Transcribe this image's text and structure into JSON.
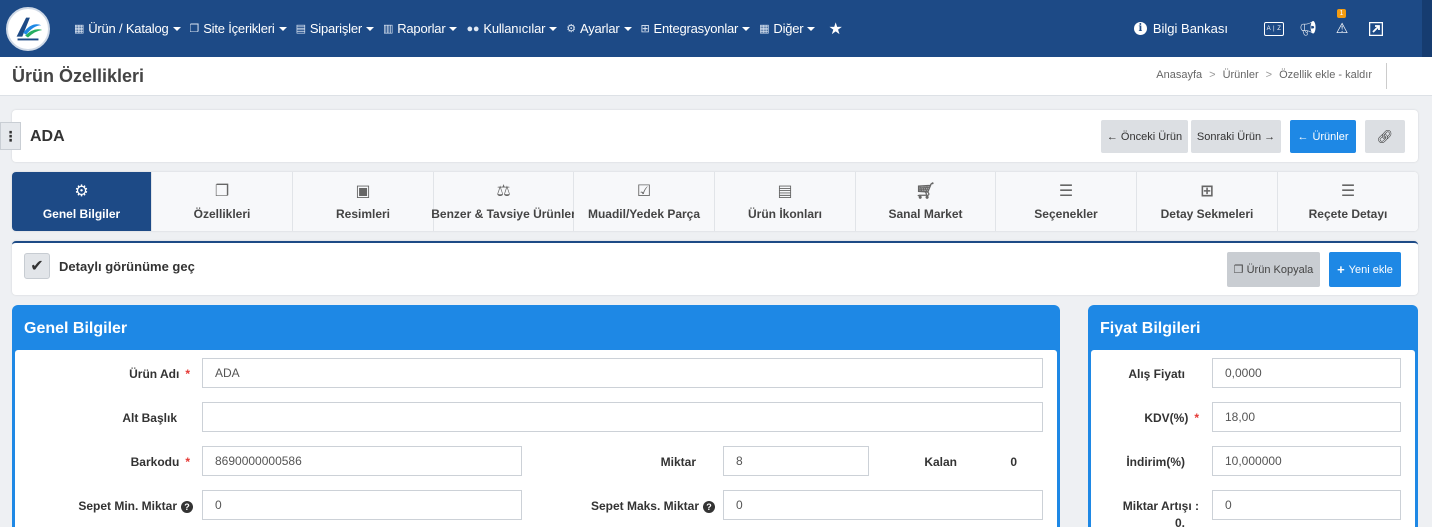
{
  "nav": {
    "menu": [
      {
        "label": "Ürün / Katalog",
        "icon": "cubes-icon"
      },
      {
        "label": "Site İçerikleri",
        "icon": "copy-icon"
      },
      {
        "label": "Siparişler",
        "icon": "truck-icon"
      },
      {
        "label": "Raporlar",
        "icon": "report-icon"
      },
      {
        "label": "Kullanıcılar",
        "icon": "users-icon"
      },
      {
        "label": "Ayarlar",
        "icon": "cogs-icon"
      },
      {
        "label": "Entegrasyonlar",
        "icon": "sitemap-icon"
      },
      {
        "label": "Diğer",
        "icon": "grid-icon"
      }
    ],
    "help_label": "Bilgi Bankası",
    "keyboard_label": "A | Z",
    "alert_badge": "1"
  },
  "page": {
    "title": "Ürün Özellikleri",
    "breadcrumb": [
      "Anasayfa",
      "Ürünler",
      "Özellik ekle - kaldır"
    ]
  },
  "product": {
    "name": "ADA",
    "prev_label": "Önceki Ürün",
    "next_label": "Sonraki Ürün",
    "products_label": "Ürünler"
  },
  "tabs": [
    {
      "label": "Genel Bilgiler",
      "icon": "cogs-icon",
      "active": true
    },
    {
      "label": "Özellikleri",
      "icon": "copy-icon"
    },
    {
      "label": "Resimleri",
      "icon": "image-icon"
    },
    {
      "label": "Benzer & Tavsiye Ürünler",
      "icon": "balance-icon"
    },
    {
      "label": "Muadil/Yedek Parça",
      "icon": "check-square-icon"
    },
    {
      "label": "Ürün İkonları",
      "icon": "file-image-icon"
    },
    {
      "label": "Sanal Market",
      "icon": "cart-icon"
    },
    {
      "label": "Seçenekler",
      "icon": "list-icon"
    },
    {
      "label": "Detay Sekmeleri",
      "icon": "sitemap-icon"
    },
    {
      "label": "Reçete Detayı",
      "icon": "list-icon"
    }
  ],
  "toolbar": {
    "detail_toggle_label": "Detaylı görünüme geç",
    "copy_label": "Ürün Kopyala",
    "new_label": "Yeni ekle"
  },
  "general": {
    "title": "Genel Bilgiler",
    "product_name_label": "Ürün Adı",
    "product_name_value": "ADA",
    "subtitle_label": "Alt Başlık",
    "subtitle_value": "",
    "barcode_label": "Barkodu",
    "barcode_value": "8690000000586",
    "quantity_label": "Miktar",
    "quantity_value": "8",
    "remaining_label": "Kalan",
    "remaining_value": "0",
    "cart_min_label": "Sepet Min. Miktar",
    "cart_min_value": "0",
    "cart_max_label": "Sepet Maks. Miktar",
    "cart_max_value": "0"
  },
  "price": {
    "title": "Fiyat Bilgileri",
    "purchase_label": "Alış Fiyatı",
    "purchase_value": "0,0000",
    "vat_label": "KDV(%)",
    "vat_value": "18,00",
    "discount_label": "İndirim(%)",
    "discount_value": "10,000000",
    "increment_label": "Miktar Artışı :",
    "increment_sub": "0.",
    "increment_value": "0"
  }
}
